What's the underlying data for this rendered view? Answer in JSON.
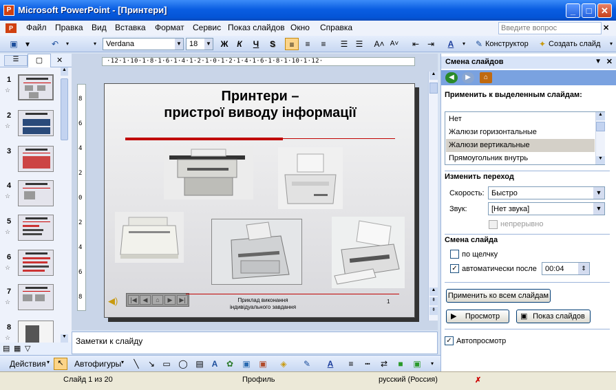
{
  "window": {
    "title": "Microsoft PowerPoint - [Принтери]"
  },
  "menu": [
    "Файл",
    "Правка",
    "Вид",
    "Вставка",
    "Формат",
    "Сервис",
    "Показ слайдов",
    "Окно",
    "Справка"
  ],
  "ask_placeholder": "Введите вопрос",
  "toolbar": {
    "font": "Verdana",
    "size": "18",
    "bold": "Ж",
    "italic": "К",
    "underline": "Ч",
    "shadow": "S",
    "designer": "Конструктор",
    "new_slide": "Создать слайд"
  },
  "ruler_h": "·12·1·10·1·8·1·6·1·4·1·2·1·0·1·2·1·4·1·6·1·8·1·10·1·12·",
  "ruler_v": [
    "8",
    "6",
    "4",
    "2",
    "0",
    "2",
    "4",
    "6",
    "8"
  ],
  "slide": {
    "title_line1": "Принтери –",
    "title_line2": "пристрої виводу інформації",
    "footer_line1": "Приклад виконання",
    "footer_line2": "індивідуального завдання",
    "number": "1"
  },
  "thumbnails": [
    "1",
    "2",
    "3",
    "4",
    "5",
    "6",
    "7",
    "8"
  ],
  "notes_placeholder": "Заметки к слайду",
  "drawbar": {
    "actions": "Действия",
    "autoshapes": "Автофигуры"
  },
  "status": {
    "slide": "Слайд 1 из 20",
    "design": "Профиль",
    "language": "русский (Россия)"
  },
  "taskpane": {
    "title": "Смена слайдов",
    "apply_label": "Применить к выделенным слайдам:",
    "effects": [
      "Нет",
      "Жалюзи горизонтальные",
      "Жалюзи вертикальные",
      "Прямоугольник внутрь"
    ],
    "selected_effect": "Жалюзи вертикальные",
    "modify_label": "Изменить переход",
    "speed_label": "Скорость:",
    "speed_value": "Быстро",
    "sound_label": "Звук:",
    "sound_value": "[Нет звука]",
    "loop_label": "непрерывно",
    "advance_label": "Смена слайда",
    "on_click_label": "по щелчку",
    "on_click_checked": false,
    "auto_label": "автоматически после",
    "auto_checked": true,
    "auto_time": "00:04",
    "apply_all": "Применить ко всем слайдам",
    "preview": "Просмотр",
    "slideshow": "Показ слайдов",
    "autopreview_label": "Автопросмотр",
    "autopreview_checked": true
  }
}
